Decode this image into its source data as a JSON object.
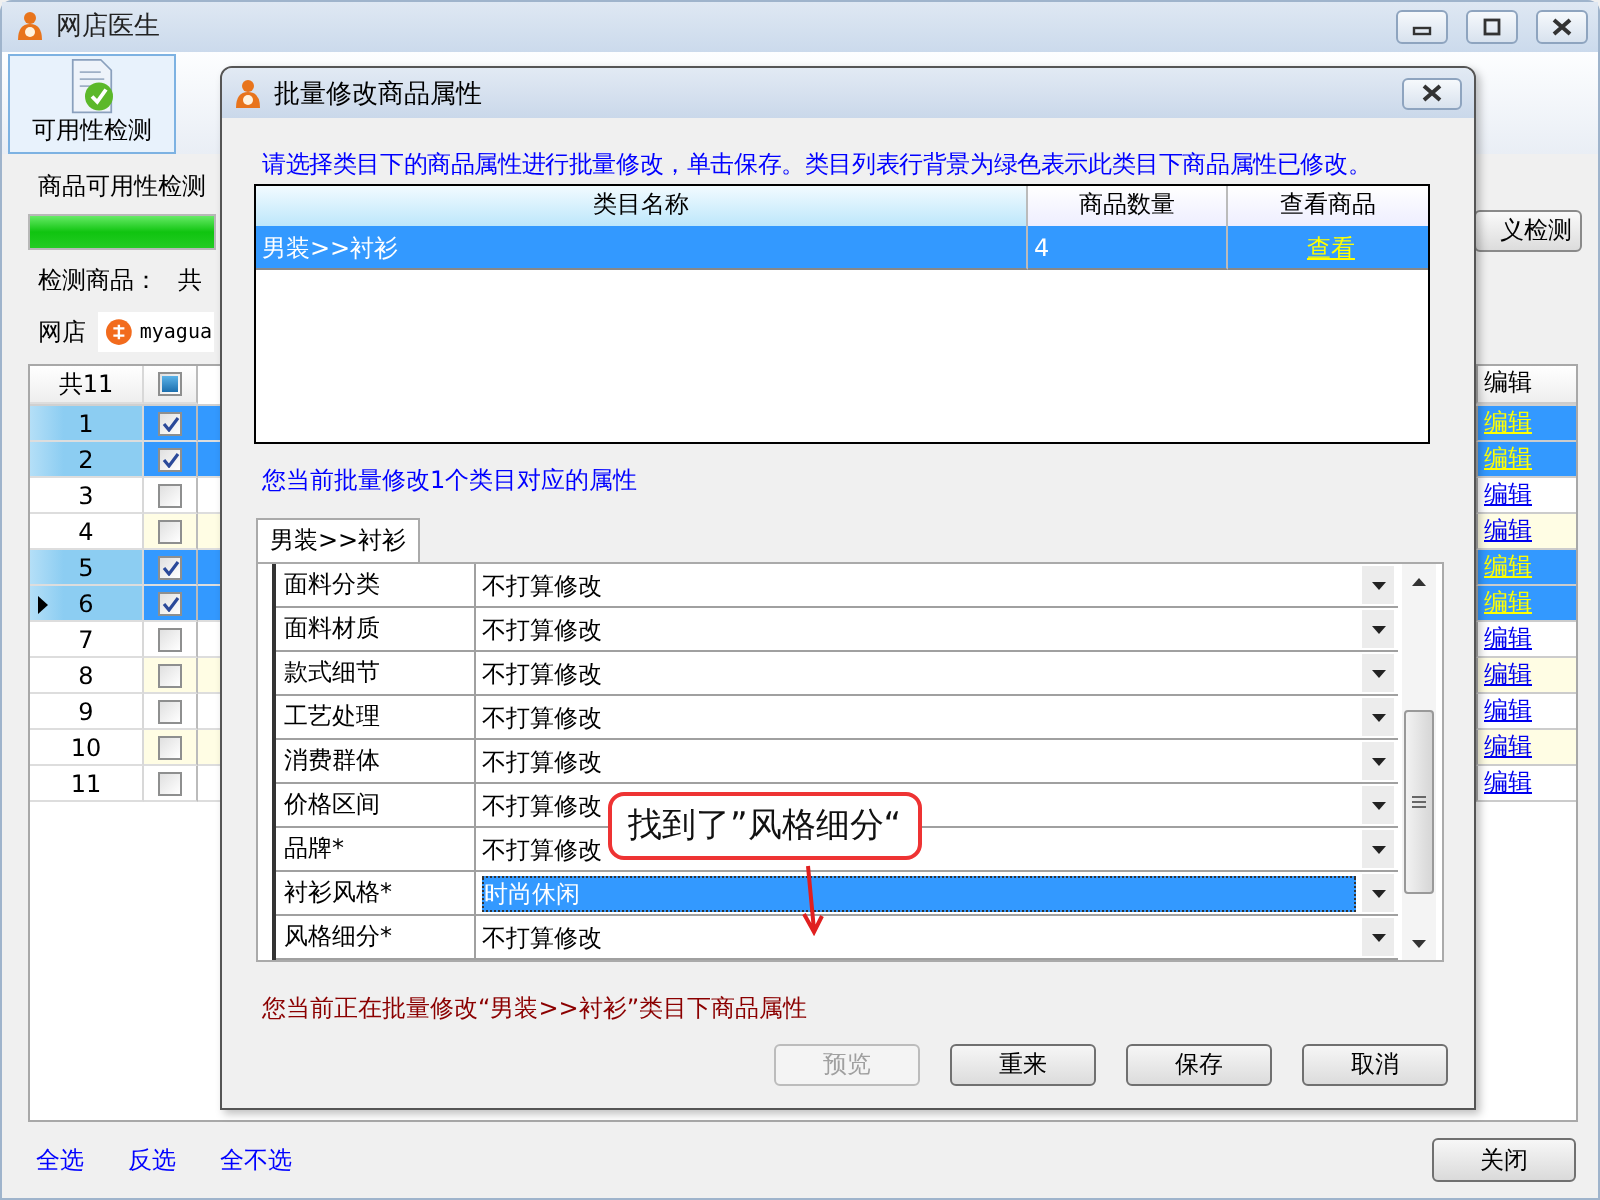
{
  "main_window": {
    "title": "网店医生",
    "toolbar": [
      {
        "label": "可用性检测",
        "selected": true
      }
    ],
    "status_text": "商品可用性检测",
    "progress": {
      "level": 1
    },
    "custom_check_button": "义检测",
    "summary_label": "检测商品：",
    "summary_text": "共",
    "shop_label": "网店",
    "shop_value": "myagua",
    "table": {
      "count_header": "共11",
      "header_checkbox_partial": true,
      "edit_header": "编辑",
      "rows": [
        {
          "number": "1",
          "checked": true,
          "selected": true,
          "current": false,
          "edit": "编辑"
        },
        {
          "number": "2",
          "checked": true,
          "selected": true,
          "current": false,
          "edit": "编辑"
        },
        {
          "number": "3",
          "checked": false,
          "selected": false,
          "current": false,
          "edit": "编辑"
        },
        {
          "number": "4",
          "checked": false,
          "selected": false,
          "current": false,
          "edit": "编辑"
        },
        {
          "number": "5",
          "checked": true,
          "selected": true,
          "current": false,
          "edit": "编辑"
        },
        {
          "number": "6",
          "checked": true,
          "selected": true,
          "current": true,
          "edit": "编辑"
        },
        {
          "number": "7",
          "checked": false,
          "selected": false,
          "current": false,
          "edit": "编辑"
        },
        {
          "number": "8",
          "checked": false,
          "selected": false,
          "current": false,
          "edit": "编辑"
        },
        {
          "number": "9",
          "checked": false,
          "selected": false,
          "current": false,
          "edit": "编辑"
        },
        {
          "number": "10",
          "checked": false,
          "selected": false,
          "current": false,
          "edit": "编辑"
        },
        {
          "number": "11",
          "checked": false,
          "selected": false,
          "current": false,
          "edit": "编辑"
        }
      ]
    },
    "bottom_links": [
      "全选",
      "反选",
      "全不选"
    ],
    "close_button": "关闭"
  },
  "dialog": {
    "title": "批量修改商品属性",
    "instruction": "请选择类目下的商品属性进行批量修改，单击保存。类目列表行背景为绿色表示此类目下商品属性已修改。",
    "columns": [
      "类目名称",
      "商品数量",
      "查看商品"
    ],
    "categories": [
      {
        "name": "男装>>衬衫",
        "count": "4",
        "link": "查看",
        "selected": true
      }
    ],
    "info": "您当前批量修改1个类目对应的属性",
    "tabs": [
      {
        "label": "男装>>衬衫",
        "selected": true
      }
    ],
    "properties": [
      {
        "name": "面料分类",
        "value": "不打算修改",
        "selected": false
      },
      {
        "name": "面料材质",
        "value": "不打算修改",
        "selected": false
      },
      {
        "name": "款式细节",
        "value": "不打算修改",
        "selected": false
      },
      {
        "name": "工艺处理",
        "value": "不打算修改",
        "selected": false
      },
      {
        "name": "消费群体",
        "value": "不打算修改",
        "selected": false
      },
      {
        "name": "价格区间",
        "value": "不打算修改",
        "selected": false
      },
      {
        "name": "品牌*",
        "value": "不打算修改",
        "selected": false
      },
      {
        "name": "衬衫风格*",
        "value": "时尚休闲",
        "selected": true
      },
      {
        "name": "风格细分*",
        "value": "不打算修改",
        "selected": false
      }
    ],
    "callout": "找到了”风格细分“",
    "status": "您当前正在批量修改“男装>>衬衫”类目下商品属性",
    "buttons": [
      {
        "label": "预览",
        "disabled": true
      },
      {
        "label": "重来",
        "disabled": false
      },
      {
        "label": "保存",
        "disabled": false
      },
      {
        "label": "取消",
        "disabled": false
      }
    ]
  }
}
